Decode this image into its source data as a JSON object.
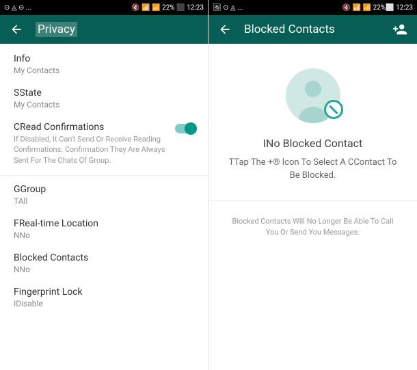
{
  "left": {
    "statusbar": {
      "leftIcons": "⊙ ◬ ⊝ ...",
      "rightIcons": "🔇 📶 📶 22% ⬛ 12:23",
      "battery": "22%",
      "time": "12:23"
    },
    "appbar": {
      "title": "Privacy"
    },
    "sections": {
      "info": {
        "title": "Info",
        "value": "My Contacts"
      },
      "state": {
        "title": "SState",
        "value": "My Contacts"
      },
      "read": {
        "title": "CRead Confirmations",
        "desc": "If Disabled, It Can't Send Or Receive Reading Confirmations. Confirmation They Are Always Sent For The Chats Of Group."
      },
      "group": {
        "title": "GGroup",
        "value": "TAll"
      },
      "location": {
        "title": "FReal-time Location",
        "value": "NNo"
      },
      "blocked": {
        "title": "Blocked Contacts",
        "value": "NNo"
      },
      "fingerprint": {
        "title": "Fingerprint Lock",
        "value": "IDisable"
      }
    }
  },
  "right": {
    "statusbar": {
      "leftIcons": "🖼 ⊙ ◬ ...",
      "rightIcons": "🔇 📶 📶 22%⬜ 12:23",
      "battery": "22%",
      "time": "12:23"
    },
    "appbar": {
      "title": "Blocked Contacts"
    },
    "empty": {
      "title": "INo Blocked Contact",
      "subtitle": "TTap The +® Icon To Select A CContact To Be Blocked."
    },
    "footer": "Blocked Contacts Will No Longer Be Able To Call You Or Send You Messages."
  }
}
